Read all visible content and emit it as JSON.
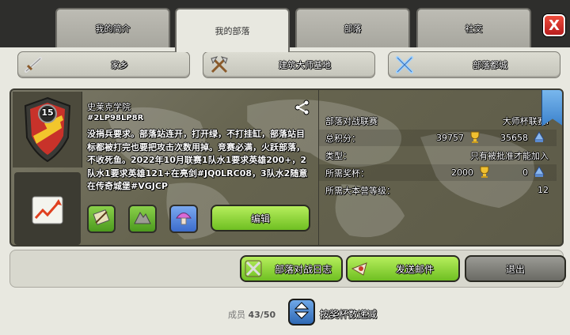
{
  "tabs": [
    {
      "label": "我的简介",
      "active": false
    },
    {
      "label": "我的部落",
      "active": true
    },
    {
      "label": "部落",
      "active": false
    },
    {
      "label": "社交",
      "active": false
    }
  ],
  "close": {
    "label": "X"
  },
  "categories": [
    {
      "label": "家乡",
      "icon": "sword-icon"
    },
    {
      "label": "建筑大师基地",
      "icon": "crossed-axes-icon"
    },
    {
      "label": "部落都城",
      "icon": "crossed-swords-icon"
    }
  ],
  "clan": {
    "level": "15",
    "name": "史莱克学院",
    "tag": "#2LP98LP8R",
    "description": "没捐兵要求。部落站连开，打开绿，不打挂缸，部落站目标都被打完也要把攻击次数用掉。竞赛必满，火跃部落，不收死鱼。2022年10月联赛1队水1要求英雄200+，2队水1要求英雄121+在亮剑#JQ0LRC08，3队水2随意在传奇城堡#VGJCP",
    "edit_label": "编辑"
  },
  "stats": {
    "league_label": "部落对战联赛",
    "league_value": "大师杯联赛I",
    "points_label": "总积分：",
    "trophies": "39757",
    "builder_trophies": "35658",
    "type_label": "类型：",
    "type_value": "只有被批准才能加入",
    "required_trophies_label": "所需奖杯：",
    "required_trophies": "2000",
    "required_builder_trophies": "0",
    "required_th_label": "所需大本营等级：",
    "required_th": "12"
  },
  "buttons": {
    "war_log": "部落对战日志",
    "send_mail": "发送邮件",
    "leave": "退出"
  },
  "members": {
    "label": "成员",
    "count": "43/50"
  },
  "sort": {
    "label": "按奖杯数递减"
  },
  "colors": {
    "green": "#7ccf2c",
    "red": "#d62a22",
    "blue": "#3c82cc",
    "gold": "#f0c030"
  }
}
